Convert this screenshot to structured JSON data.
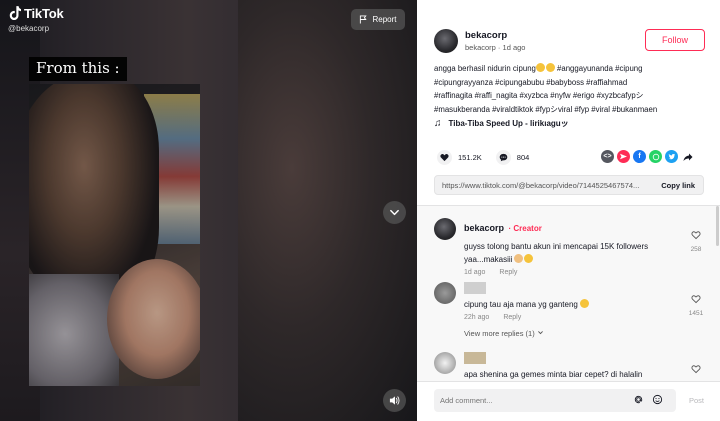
{
  "app": {
    "logo_text": "TikTok",
    "handle": "@bekacorp"
  },
  "video": {
    "caption": "From this :",
    "report_label": "Report"
  },
  "author": {
    "name": "bekacorp",
    "sub": "bekacorp · 1d ago",
    "follow_label": "Follow"
  },
  "description": {
    "line1_a": "angga berhasil nidurin cipung",
    "line1_b": "#anggayunanda #cipung",
    "line2": "#cipungrayyanza #cipungabubu #babyboss #raffiahmad",
    "line3": "#raffinagita #raffi_nagita #xyzbca #nyfw #erigo #xyzbcafypシ",
    "line4": "#masukberanda #viraldtiktok #fypシviral #fyp #viral #bukanmaen"
  },
  "music": {
    "title": "Tiba-Tiba Speed Up - lirikıaguッ"
  },
  "actions": {
    "likes": "151.2K",
    "comments": "804"
  },
  "link": {
    "url": "https://www.tiktok.com/@bekacorp/video/7144525467574...",
    "copy_label": "Copy link"
  },
  "comments": [
    {
      "name": "bekacorp",
      "badge": "Creator",
      "text": "guyss tolong bantu akun ini mencapai 15K followers yaa...makasiii",
      "time": "1d ago",
      "reply": "Reply",
      "likes": "258"
    },
    {
      "text": "cipung tau aja mana yg ganteng",
      "time": "22h ago",
      "reply": "Reply",
      "likes": "1451",
      "view_more": "View more replies (1)"
    },
    {
      "text": "apa shenina ga gemes minta biar cepet? di halalin",
      "likes": ""
    }
  ],
  "comment_bar": {
    "placeholder": "Add comment...",
    "post_label": "Post"
  },
  "colors": {
    "accent": "#fe2c55",
    "pinterest": "#fe2c55",
    "facebook": "#1877f2",
    "whatsapp": "#25d366",
    "twitter": "#1da1f2"
  }
}
